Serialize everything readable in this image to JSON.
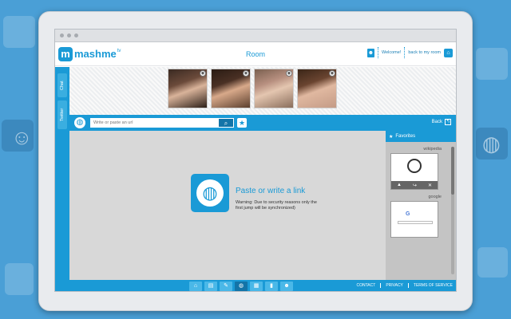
{
  "header": {
    "app_name": "mashme",
    "app_superscript": "tv",
    "logo_letter": "m",
    "room_title": "Room",
    "welcome": "Welcome!",
    "back_to_room": "back to my room"
  },
  "sidebar": {
    "tabs": [
      {
        "label": "Chat"
      },
      {
        "label": "Twitter"
      }
    ]
  },
  "urlbar": {
    "placeholder": "Write or paste an url",
    "back_label": "Back"
  },
  "content": {
    "title": "Paste or write a link",
    "warning": "Warning: Due to security reasons only the first jump will be synchronized)"
  },
  "favorites": {
    "title": "Favorites",
    "items": [
      {
        "label": "wikipedia"
      },
      {
        "label": "google"
      }
    ]
  },
  "footer": {
    "links": [
      "CONTACT",
      "PRIVACY",
      "TERMS OF SERVICE"
    ]
  },
  "icons": {
    "brand": "#1a9ad6"
  }
}
